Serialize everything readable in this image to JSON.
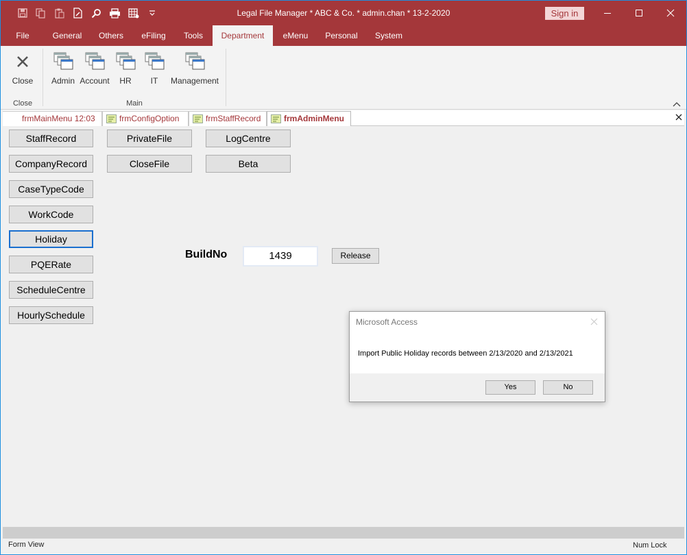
{
  "window": {
    "title": "Legal File Manager * ABC & Co. * admin.chan * 13-2-2020",
    "sign_in": "Sign in"
  },
  "ribbon_tabs": [
    "File",
    "General",
    "Others",
    "eFiling",
    "Tools",
    "Department",
    "eMenu",
    "Personal",
    "System"
  ],
  "ribbon": {
    "close_label": "Close",
    "close_group": "Close",
    "main_group": "Main",
    "buttons": [
      "Admin",
      "Account",
      "HR",
      "IT",
      "Management"
    ]
  },
  "doc_tabs": [
    "frmMainMenu 12:03",
    "frmConfigOption",
    "frmStaffRecord",
    "frmAdminMenu"
  ],
  "form": {
    "col1": [
      "StaffRecord",
      "CompanyRecord",
      "CaseTypeCode",
      "WorkCode",
      "Holiday",
      "PQERate",
      "ScheduleCentre",
      "HourlySchedule"
    ],
    "col2": [
      "PrivateFile",
      "CloseFile"
    ],
    "col3": [
      "LogCentre",
      "Beta"
    ],
    "build_label": "BuildNo",
    "build_value": "1439",
    "release_label": "Release"
  },
  "dialog": {
    "title": "Microsoft Access",
    "message": "Import Public Holiday records between 2/13/2020 and 2/13/2021",
    "yes": "Yes",
    "no": "No"
  },
  "status": {
    "left": "Form View",
    "right": "Num Lock"
  },
  "colors": {
    "accent": "#a4373a",
    "focus": "#1a6fcf"
  }
}
